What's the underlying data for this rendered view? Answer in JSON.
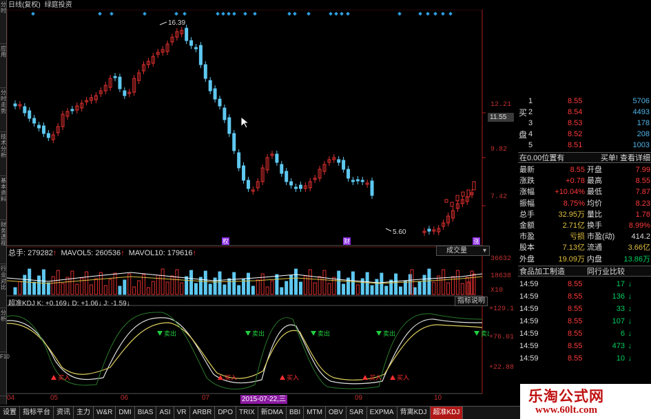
{
  "titlebar": {
    "period": "日线(复权)",
    "name": "绿庭投资"
  },
  "leftbar": [
    "分时",
    "应用",
    "分时走势",
    "技术分析",
    "基本资料",
    "财务透视",
    "行业对比",
    "分析",
    "F10"
  ],
  "price_axis": {
    "high_label": "16.39",
    "low_label": "5.60",
    "ticks": [
      "12.21",
      "9.82",
      "7.42"
    ],
    "current": "11.55"
  },
  "events": {
    "e1": "权",
    "e2": "财",
    "e3": "涨"
  },
  "volume": {
    "total_label": "总手: 279282",
    "ma5_label": "MAVOL5: 260536",
    "ma10_label": "MAVOL10: 179616",
    "button": "成交量",
    "ticks": [
      "36632",
      "18638"
    ],
    "unit": "X10"
  },
  "kdj": {
    "header": "超准KDJ K: +0.169↓ D: +1.06↓ J: -1.59↓",
    "button": "指标说明",
    "ticks": [
      "+129.1",
      "+76.01",
      "+22.88"
    ],
    "sell": "卖出",
    "buy": "买入"
  },
  "xaxis": {
    "labels": [
      "04",
      "05",
      "06",
      "07",
      "09",
      "10"
    ],
    "date_badge": "2015-07-22,三"
  },
  "tabs": [
    "设置",
    "指标平台",
    "资讯",
    "主力",
    "W&R",
    "DMI",
    "BIAS",
    "ASI",
    "VR",
    "ARBR",
    "DPO",
    "TRIX",
    "新DMA",
    "BBI",
    "MTM",
    "OBV",
    "SAR",
    "EXPMA",
    "背离KDJ",
    "超准KDJ"
  ],
  "active_tab": "超准KDJ",
  "orderbook": {
    "side_labels": [
      "买",
      "盘"
    ],
    "rows": [
      {
        "lvl": "1",
        "price": "8.55",
        "vol": "5706"
      },
      {
        "lvl": "2",
        "price": "8.54",
        "vol": "4493"
      },
      {
        "lvl": "3",
        "price": "8.53",
        "vol": "178"
      },
      {
        "lvl": "4",
        "price": "8.52",
        "vol": "208"
      },
      {
        "lvl": "5",
        "price": "8.51",
        "vol": "1003"
      }
    ]
  },
  "position": {
    "left": "在0.00位置有",
    "right": "买单! 查看详细"
  },
  "quote": [
    {
      "l1": "最新",
      "v1": "8.55",
      "l2": "开盘",
      "v2": "7.99"
    },
    {
      "l1": "涨跌",
      "v1": "+0.78",
      "l2": "最高",
      "v2": "8.55"
    },
    {
      "l1": "涨幅",
      "v1": "+10.04%",
      "l2": "最低",
      "v2": "7.87"
    },
    {
      "l1": "振幅",
      "v1": "8.75%",
      "l2": "均价",
      "v2": "8.23"
    },
    {
      "l1": "总手",
      "v1": "32.95万",
      "l2": "量比",
      "v2": "1.78"
    },
    {
      "l1": "金额",
      "v1": "2.71亿",
      "l2": "换手",
      "v2": "8.99%"
    },
    {
      "l1": "市盈",
      "v1": "亏损",
      "l2": "市盈(动)",
      "v2": "414.2"
    },
    {
      "l1": "股本",
      "v1": "7.13亿",
      "l2": "流通",
      "v2": "3.66亿"
    },
    {
      "l1": "外盘",
      "v1": "19.09万",
      "l2": "内盘",
      "v2": "13.86万"
    }
  ],
  "industry": {
    "left": "食品加工制造",
    "right": "同行业比较"
  },
  "ticks": [
    {
      "t": "14:59",
      "p": "8.55",
      "v": "17"
    },
    {
      "t": "14:59",
      "p": "8.55",
      "v": "136"
    },
    {
      "t": "14:59",
      "p": "8.55",
      "v": "33"
    },
    {
      "t": "14:59",
      "p": "8.55",
      "v": "107"
    },
    {
      "t": "14:59",
      "p": "8.55",
      "v": "6"
    },
    {
      "t": "14:59",
      "p": "8.55",
      "v": "473"
    },
    {
      "t": "14:59",
      "p": "8.55",
      "v": "10"
    }
  ],
  "watermark": {
    "line1": "乐淘公式网",
    "line2": "www.60lt.com"
  },
  "colors": {
    "up": "#e03030",
    "down": "#5ec8f0",
    "bg": "#000000",
    "grid": "#5a1010"
  }
}
